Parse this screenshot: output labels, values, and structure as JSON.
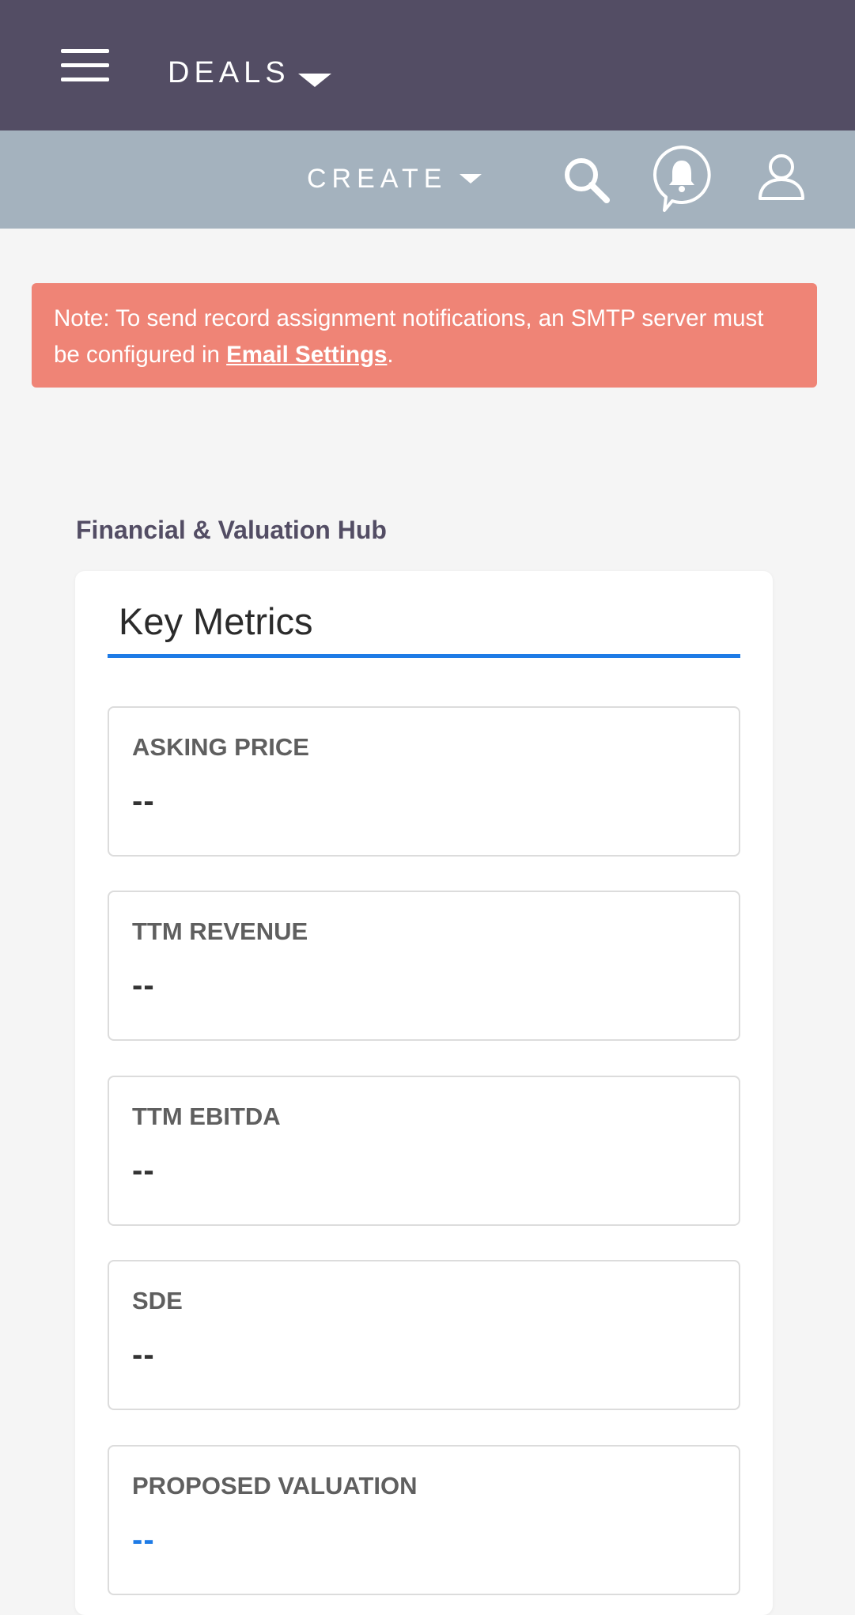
{
  "header": {
    "module_label": "DEALS",
    "create_label": "CREATE"
  },
  "icons": {
    "menu": "hamburger-icon",
    "module_caret": "caret-down-icon",
    "create_caret": "caret-down-icon",
    "search": "search-icon",
    "notifications": "bell-icon",
    "profile": "user-icon"
  },
  "alert": {
    "text_before": "Note: To send record assignment notifications, an SMTP server must be configured in ",
    "link_text": "Email Settings",
    "text_after": "."
  },
  "hub": {
    "title": "Financial & Valuation Hub",
    "tab_label": "Key Metrics",
    "fields": [
      {
        "label": "ASKING PRICE",
        "value": "--"
      },
      {
        "label": "TTM REVENUE",
        "value": "--"
      },
      {
        "label": "TTM EBITDA",
        "value": "--"
      },
      {
        "label": "SDE",
        "value": "--"
      },
      {
        "label": "PROPOSED VALUATION",
        "value": "--"
      }
    ]
  },
  "colors": {
    "topbar": "#534d64",
    "subbar": "#a4b2be",
    "alert": "#ef8476",
    "accent": "#1e7be6"
  }
}
